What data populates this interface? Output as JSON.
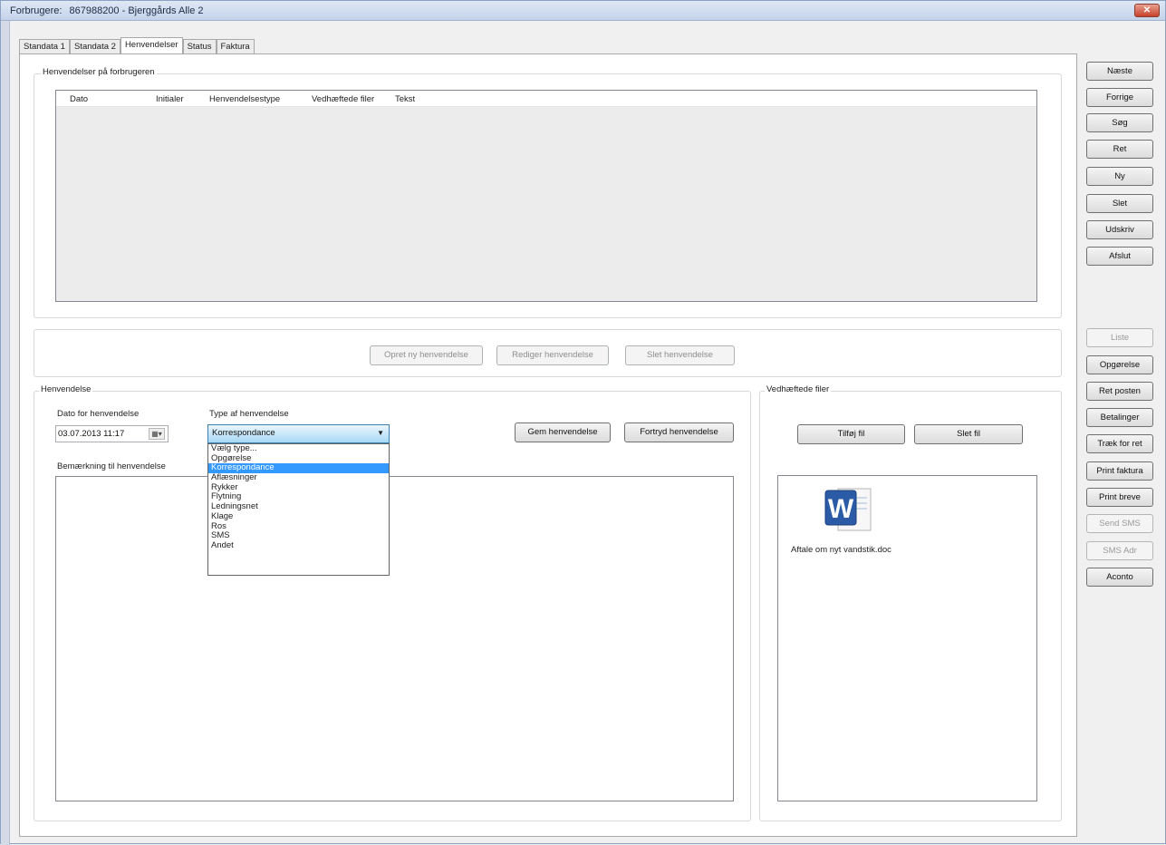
{
  "window": {
    "title": "Forbrugere:",
    "subtitle": "867988200 - Bjerggårds Alle 2",
    "close": "✕"
  },
  "tabs": [
    "Standata 1",
    "Standata 2",
    "Henvendelser",
    "Status",
    "Faktura"
  ],
  "henvendelser_group": {
    "label": "Henvendelser på forbrugeren",
    "columns": [
      "Dato",
      "Initialer",
      "Henvendelsestype",
      "Vedhæftede filer",
      "Tekst"
    ]
  },
  "actions": {
    "create": "Opret ny henvendelse",
    "edit": "Rediger henvendelse",
    "delete": "Slet henvendelse"
  },
  "henvendelse_group": {
    "label": "Henvendelse",
    "date_label": "Dato for henvendelse",
    "date_value": "03.07.2013 11:17",
    "type_label": "Type af henvendelse",
    "type_value": "Korrespondance",
    "save": "Gem henvendelse",
    "cancel": "Fortryd henvendelse",
    "remark_label": "Bemærkning til henvendelse",
    "type_options": [
      "Vælg type...",
      "Opgørelse",
      "Korrespondance",
      "Aflæsninger",
      "Rykker",
      "Flytning",
      "Ledningsnet",
      "Klage",
      "Ros",
      "SMS",
      "Andet"
    ],
    "selected_index": 2
  },
  "files_group": {
    "label": "Vedhæftede filer",
    "add": "Tilføj fil",
    "delete": "Slet fil",
    "file_name": "Aftale om nyt vandstik.doc"
  },
  "side_buttons": {
    "top": [
      "Næste",
      "Forrige",
      "Søg",
      "Ret",
      "Ny",
      "Slet",
      "Udskriv",
      "Afslut"
    ],
    "bottom": [
      "Liste",
      "Opgørelse",
      "Ret posten",
      "Betalinger",
      "Træk for ret",
      "Print faktura",
      "Print breve",
      "Send SMS",
      "SMS Adr",
      "Aconto"
    ]
  }
}
